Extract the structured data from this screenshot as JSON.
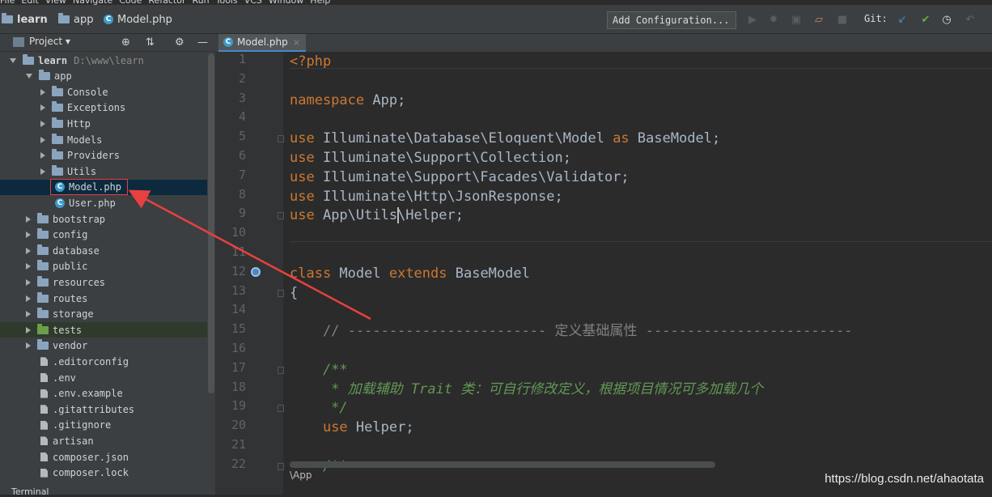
{
  "menu": [
    "File",
    "Edit",
    "View",
    "Navigate",
    "Code",
    "Refactor",
    "Run",
    "Tools",
    "VCS",
    "Window",
    "Help"
  ],
  "breadcrumb": [
    {
      "label": "learn",
      "icon": "folder-icon"
    },
    {
      "label": "app",
      "icon": "folder-icon"
    },
    {
      "label": "Model.php",
      "icon": "php-file-icon"
    }
  ],
  "toolbar": {
    "add_configuration": "Add Configuration...",
    "git_label": "Git:",
    "icons": [
      "run-icon",
      "debug-icon",
      "coverage-icon",
      "profile-icon",
      "stop-icon",
      "vcs-update-icon",
      "vcs-commit-icon",
      "history-icon",
      "rollback-icon"
    ]
  },
  "project_panel": {
    "title": "Project",
    "header_icons": [
      "target-icon",
      "collapse-icon",
      "gear-icon",
      "minimize-icon"
    ],
    "tree": [
      {
        "label": "learn",
        "path": "D:\\www\\learn",
        "type": "folder",
        "depth": 0,
        "expanded": true
      },
      {
        "label": "app",
        "type": "folder",
        "depth": 1,
        "expanded": true
      },
      {
        "label": "Console",
        "type": "folder",
        "depth": 2,
        "expanded": false
      },
      {
        "label": "Exceptions",
        "type": "folder",
        "depth": 2,
        "expanded": false
      },
      {
        "label": "Http",
        "type": "folder",
        "depth": 2,
        "expanded": false
      },
      {
        "label": "Models",
        "type": "folder",
        "depth": 2,
        "expanded": false
      },
      {
        "label": "Providers",
        "type": "folder",
        "depth": 2,
        "expanded": false
      },
      {
        "label": "Utils",
        "type": "folder",
        "depth": 2,
        "expanded": false
      },
      {
        "label": "Model.php",
        "type": "php",
        "depth": 3,
        "selected": true
      },
      {
        "label": "User.php",
        "type": "php",
        "depth": 3
      },
      {
        "label": "bootstrap",
        "type": "folder",
        "depth": 1,
        "expanded": false
      },
      {
        "label": "config",
        "type": "folder",
        "depth": 1,
        "expanded": false
      },
      {
        "label": "database",
        "type": "folder",
        "depth": 1,
        "expanded": false
      },
      {
        "label": "public",
        "type": "folder",
        "depth": 1,
        "expanded": false
      },
      {
        "label": "resources",
        "type": "folder",
        "depth": 1,
        "expanded": false
      },
      {
        "label": "routes",
        "type": "folder",
        "depth": 1,
        "expanded": false
      },
      {
        "label": "storage",
        "type": "folder",
        "depth": 1,
        "expanded": false
      },
      {
        "label": "tests",
        "type": "folder-green",
        "depth": 1,
        "expanded": false,
        "highlight": true
      },
      {
        "label": "vendor",
        "type": "folder",
        "depth": 1,
        "expanded": false
      },
      {
        "label": ".editorconfig",
        "type": "file",
        "depth": 2
      },
      {
        "label": ".env",
        "type": "file",
        "depth": 2
      },
      {
        "label": ".env.example",
        "type": "file",
        "depth": 2
      },
      {
        "label": ".gitattributes",
        "type": "file",
        "depth": 2
      },
      {
        "label": ".gitignore",
        "type": "file",
        "depth": 2
      },
      {
        "label": "artisan",
        "type": "file",
        "depth": 2
      },
      {
        "label": "composer.json",
        "type": "file",
        "depth": 2
      },
      {
        "label": "composer.lock",
        "type": "file",
        "depth": 2
      }
    ]
  },
  "editor": {
    "tab_label": "Model.php",
    "line_numbers": [
      "1",
      "2",
      "3",
      "4",
      "5",
      "6",
      "7",
      "8",
      "9",
      "10",
      "11",
      "12",
      "13",
      "14",
      "15",
      "16",
      "17",
      "18",
      "19",
      "20",
      "21",
      "22"
    ],
    "lines": [
      [
        {
          "t": "<?php",
          "c": "kw"
        }
      ],
      [],
      [
        {
          "t": "namespace",
          "c": "kw"
        },
        {
          "t": " App;",
          "c": ""
        }
      ],
      [],
      [
        {
          "t": "use",
          "c": "kw"
        },
        {
          "t": " Illuminate\\Database\\Eloquent\\Model ",
          "c": ""
        },
        {
          "t": "as",
          "c": "kw"
        },
        {
          "t": " BaseModel;",
          "c": ""
        }
      ],
      [
        {
          "t": "use",
          "c": "kw"
        },
        {
          "t": " Illuminate\\Support\\Collection;",
          "c": ""
        }
      ],
      [
        {
          "t": "use",
          "c": "kw"
        },
        {
          "t": " Illuminate\\Support\\Facades\\Validator;",
          "c": ""
        }
      ],
      [
        {
          "t": "use",
          "c": "kw"
        },
        {
          "t": " Illuminate\\Http\\JsonResponse;",
          "c": ""
        }
      ],
      [
        {
          "t": "use",
          "c": "kw"
        },
        {
          "t": " App\\Utils\\Helper;",
          "c": ""
        }
      ],
      [],
      [],
      [
        {
          "t": "class",
          "c": "kw"
        },
        {
          "t": " Model ",
          "c": ""
        },
        {
          "t": "extends",
          "c": "kw"
        },
        {
          "t": " BaseModel",
          "c": ""
        }
      ],
      [
        {
          "t": "{",
          "c": ""
        }
      ],
      [],
      [
        {
          "t": "    // ------------------------ 定义基础属性 -------------------------",
          "c": "cm"
        }
      ],
      [],
      [
        {
          "t": "    /**",
          "c": "dc"
        }
      ],
      [
        {
          "t": "     * 加载辅助 Trait 类：可自行修改定义，根据项目情况可多加载几个",
          "c": "dc"
        }
      ],
      [
        {
          "t": "     */",
          "c": "dc"
        }
      ],
      [
        {
          "t": "    ",
          "c": ""
        },
        {
          "t": "use",
          "c": "kw"
        },
        {
          "t": " Helper;",
          "c": ""
        }
      ],
      [],
      [
        {
          "t": "    /**",
          "c": "dc"
        }
      ]
    ],
    "status_path": "\\App"
  },
  "bottom_tab": "Terminal",
  "watermark": "https://blog.csdn.net/ahaotata",
  "colors": {
    "keyword": "#cc7832",
    "comment": "#808080",
    "doc": "#629755",
    "annotation": "#e84040",
    "selection": "#0d293e"
  }
}
